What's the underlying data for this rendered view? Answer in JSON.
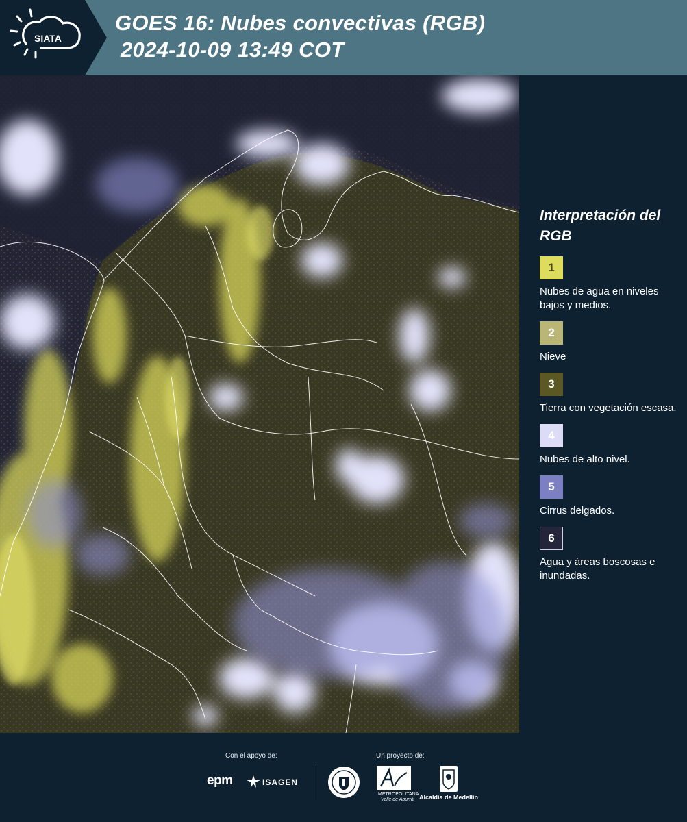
{
  "header": {
    "logo_text": "SIATA",
    "title_line1": "GOES 16: Nubes convectivas (RGB)",
    "title_line2": "2024-10-09 13:49 COT",
    "background_color": "#4d7584",
    "logo_bg_color": "#0e2130"
  },
  "map": {
    "image_type": "satellite-rgb-composite",
    "base_color": "#212434",
    "boundary_color": "#ffffff"
  },
  "legend": {
    "title": "Interpretación del RGB",
    "items": [
      {
        "number": "1",
        "label": "Nubes de agua en niveles bajos y medios.",
        "color": "#dedc5d"
      },
      {
        "number": "2",
        "label": "Nieve",
        "color": "#bab675"
      },
      {
        "number": "3",
        "label": "Tierra con vegetación escasa.",
        "color": "#5b5823"
      },
      {
        "number": "4",
        "label": "Nubes de alto nivel.",
        "color": "#dcdcf6"
      },
      {
        "number": "5",
        "label": "Cirrus delgados.",
        "color": "#7c7fc2"
      },
      {
        "number": "6",
        "label": "Agua y áreas boscosas e inundadas.",
        "color": "#24243a"
      }
    ]
  },
  "footer": {
    "support_caption": "Con el apoyo de:",
    "project_caption": "Un proyecto de:",
    "support_logos": [
      "epm",
      "ISAGEN"
    ],
    "epm_text": "epm",
    "isagen_text": "ISAGEN",
    "partner_logos": [
      "Universidad Nacional seal",
      "Área Metropolitana Valle de Aburrá",
      "Alcaldía de Medellín"
    ],
    "area_caption": "METROPOLITANA",
    "area_sub_caption": "Valle de Aburrá",
    "alcaldia_text": "Alcaldía de Medellín"
  }
}
